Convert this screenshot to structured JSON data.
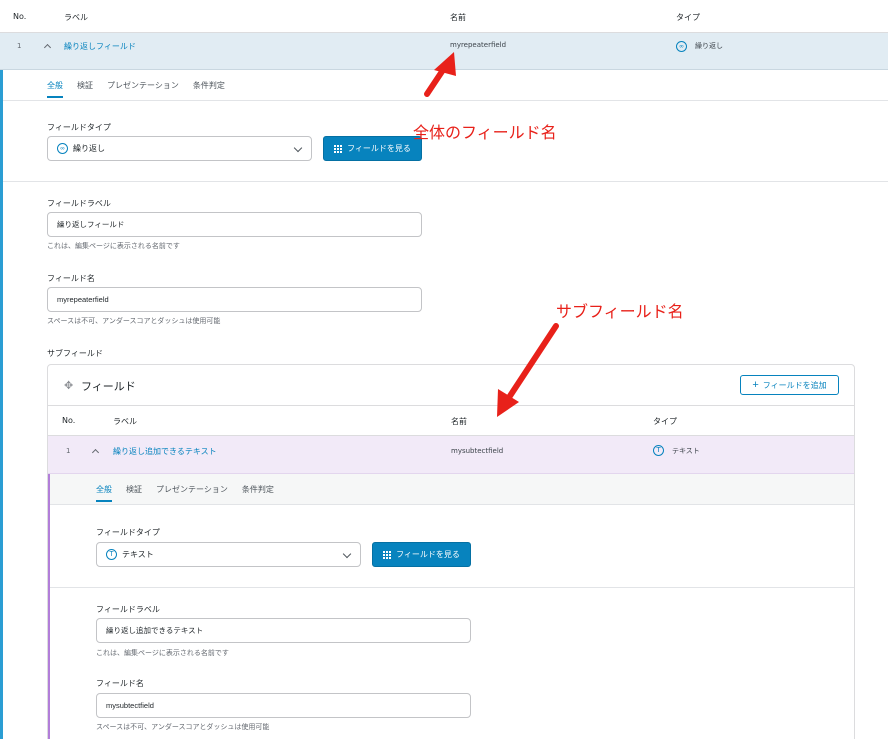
{
  "table_header": {
    "no": "No.",
    "label": "ラベル",
    "name": "名前",
    "type": "タイプ"
  },
  "field": {
    "no": "1",
    "label": "繰り返しフィールド",
    "name": "myrepeaterfield",
    "type": "繰り返し",
    "type_icon": "infinity-icon",
    "tabs": [
      "全般",
      "検証",
      "プレゼンテーション",
      "条件判定"
    ],
    "field_type_label": "フィールドタイプ",
    "field_type_value": "繰り返し",
    "browse_button": "フィールドを見る",
    "field_label_label": "フィールドラベル",
    "field_label_value": "繰り返しフィールド",
    "field_label_help": "これは、編集ページに表示される名前です",
    "field_name_label": "フィールド名",
    "field_name_value": "myrepeaterfield",
    "field_name_help": "スペースは不可、アンダースコアとダッシュは使用可能",
    "subfields_label": "サブフィールド"
  },
  "sub": {
    "panel_title": "フィールド",
    "add_button": "フィールドを追加",
    "header": {
      "no": "No.",
      "label": "ラベル",
      "name": "名前",
      "type": "タイプ"
    },
    "no": "1",
    "label": "繰り返し追加できるテキスト",
    "name": "mysubtectfield",
    "type": "テキスト",
    "type_icon": "text-T-icon",
    "tabs": [
      "全般",
      "検証",
      "プレゼンテーション",
      "条件判定"
    ],
    "field_type_label": "フィールドタイプ",
    "field_type_value": "テキスト",
    "browse_button": "フィールドを見る",
    "field_label_label": "フィールドラベル",
    "field_label_value": "繰り返し追加できるテキスト",
    "field_label_help": "これは、編集ページに表示される名前です",
    "field_name_label": "フィールド名",
    "field_name_value": "mysubtectfield",
    "field_name_help": "スペースは不可、アンダースコアとダッシュは使用可能"
  },
  "annotations": {
    "top": "全体のフィールド名",
    "sub": "サブフィールド名"
  },
  "colors": {
    "accent": "#0783be",
    "annotation": "#e8211a",
    "sub_accent": "#b27ed9"
  }
}
